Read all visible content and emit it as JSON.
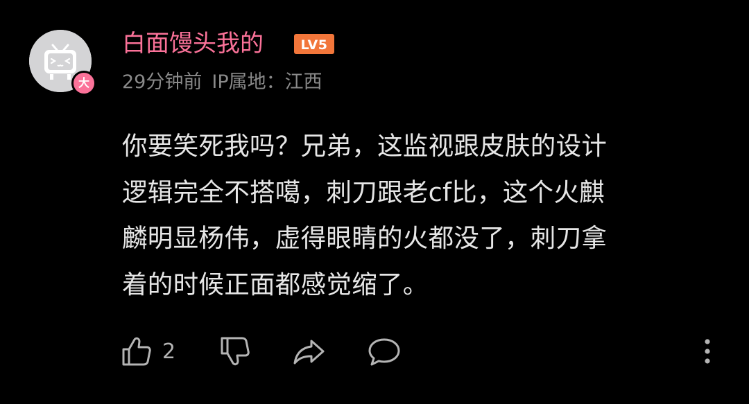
{
  "comment": {
    "username": "白面馒头我的",
    "level_badge": "LV5",
    "avatar_badge": "大",
    "time_ago": "29分钟前",
    "ip_location": "IP属地：江西",
    "text_lines": [
      "你要笑死我吗？兄弟，这监视跟皮肤的设计",
      "逻辑完全不搭噶，刺刀跟老cf比，这个火麒",
      "麟明显杨伟，虚得眼睛的火都没了，刺刀拿",
      "着的时候正面都感觉缩了。"
    ],
    "like_count": "2"
  },
  "colors": {
    "background": "#000000",
    "username": "#fb7299",
    "level_badge": "#f2763a",
    "meta_text": "#8a8a8a",
    "body_text": "#e6e6e6",
    "icon": "#b4b4b4"
  },
  "icons": {
    "like": "thumbs-up-icon",
    "dislike": "thumbs-down-icon",
    "share": "share-icon",
    "reply": "comment-bubble-icon",
    "more": "more-vertical-icon"
  }
}
